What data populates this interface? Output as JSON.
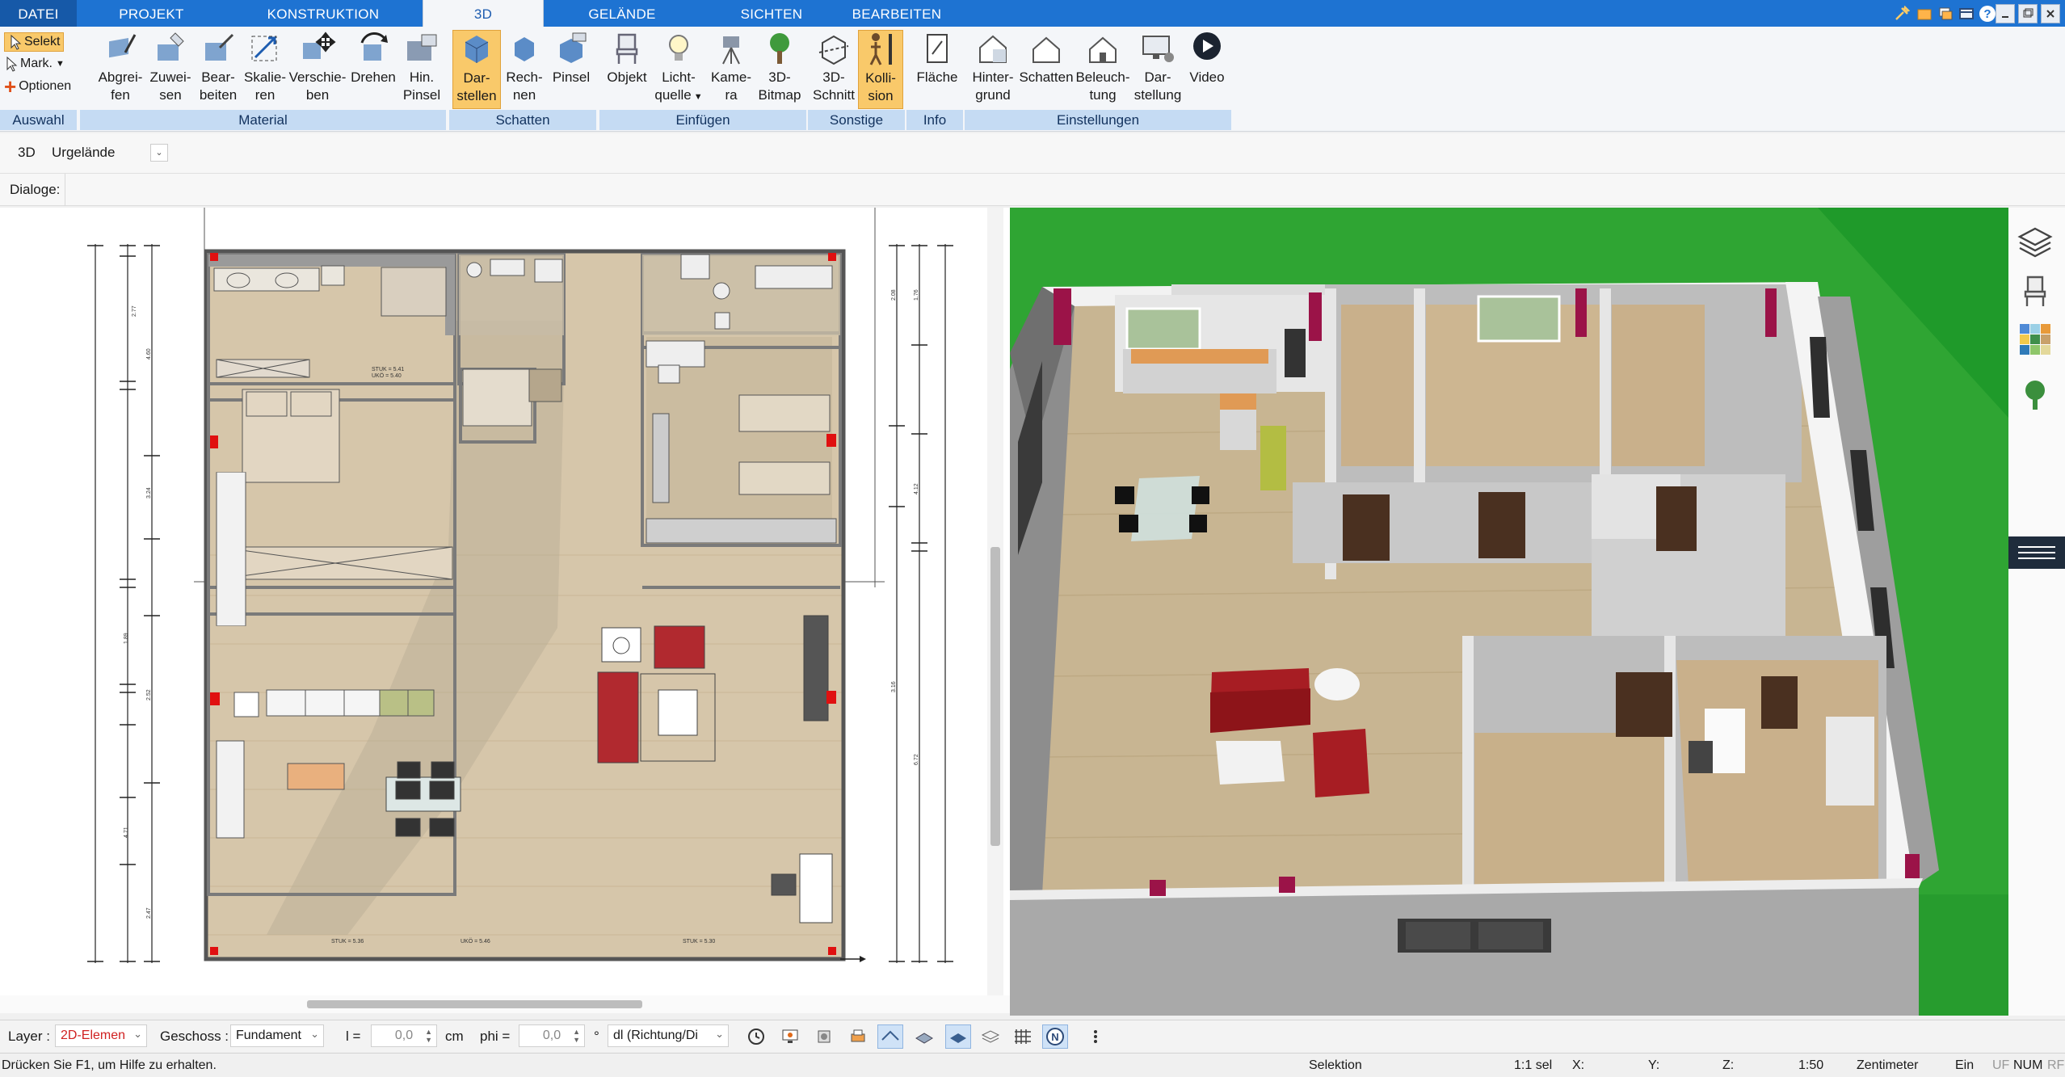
{
  "menu": {
    "tabs": [
      "DATEI",
      "PROJEKT",
      "KONSTRUKTION",
      "3D",
      "GELÄNDE",
      "SICHTEN",
      "BEARBEITEN"
    ],
    "active_tab": "3D"
  },
  "ribbon": {
    "auswahl": {
      "select_label": "Selekt",
      "mark_label": "Mark.",
      "options_label": "Optionen",
      "group": "Auswahl"
    },
    "material": {
      "group": "Material",
      "buttons": [
        {
          "l1": "Abgrei-",
          "l2": "fen"
        },
        {
          "l1": "Zuwei-",
          "l2": "sen"
        },
        {
          "l1": "Bear-",
          "l2": "beiten"
        },
        {
          "l1": "Skalie-",
          "l2": "ren"
        },
        {
          "l1": "Verschie-",
          "l2": "ben"
        },
        {
          "l1": "Drehen",
          "l2": ""
        },
        {
          "l1": "Hin.",
          "l2": "Pinsel"
        }
      ]
    },
    "schatten": {
      "group": "Schatten",
      "buttons": [
        {
          "l1": "Dar-",
          "l2": "stellen"
        },
        {
          "l1": "Rech-",
          "l2": "nen"
        },
        {
          "l1": "Pinsel",
          "l2": ""
        }
      ]
    },
    "einfuegen": {
      "group": "Einfügen",
      "buttons": [
        {
          "l1": "Objekt",
          "l2": ""
        },
        {
          "l1": "Licht-",
          "l2": "quelle"
        },
        {
          "l1": "Kame-",
          "l2": "ra"
        },
        {
          "l1": "3D-",
          "l2": "Bitmap"
        }
      ]
    },
    "sonstige": {
      "group": "Sonstige",
      "buttons": [
        {
          "l1": "3D-",
          "l2": "Schnitt"
        },
        {
          "l1": "Kolli-",
          "l2": "sion"
        }
      ]
    },
    "info": {
      "group": "Info",
      "buttons": [
        {
          "l1": "Fläche",
          "l2": ""
        }
      ]
    },
    "einstellungen": {
      "group": "Einstellungen",
      "buttons": [
        {
          "l1": "Hinter-",
          "l2": "grund"
        },
        {
          "l1": "Schatten",
          "l2": ""
        },
        {
          "l1": "Beleuch-",
          "l2": "tung"
        },
        {
          "l1": "Dar-",
          "l2": "stellung"
        },
        {
          "l1": "Video",
          "l2": ""
        }
      ]
    }
  },
  "toolbar": {
    "mode": "3D",
    "terrain": "Urgelände",
    "dialogs_label": "Dialoge:"
  },
  "bottom": {
    "layer_label": "Layer :",
    "layer_value": "2D-Elemen",
    "floor_label": "Geschoss :",
    "floor_value": "Fundament",
    "l_label": "l =",
    "l_value": "0,0",
    "l_unit": "cm",
    "phi_label": "phi =",
    "phi_value": "0,0",
    "phi_unit": "°",
    "dl_value": "dl (Richtung/Di"
  },
  "status": {
    "help": "Drücken Sie F1, um Hilfe zu erhalten.",
    "mode": "Selektion",
    "sel": "1:1 sel",
    "x": "X:",
    "y": "Y:",
    "z": "Z:",
    "scale": "1:50",
    "unit": "Zentimeter",
    "ein": "Ein",
    "uf": "UF",
    "num": "NUM",
    "rf": "RF"
  },
  "plan_labels": {
    "dims_left": [
      "2.77",
      "4.60",
      "3.24",
      "1.89",
      "2.52",
      "4.71",
      "2.47"
    ],
    "dims_right": [
      "2.08",
      "1.76",
      "4.12",
      "3.16",
      "6.72"
    ],
    "room_tags": [
      "STUK = 5.41",
      "UKÖ = 5.40",
      "STUK = 5.36",
      "UKÖ = 5.46",
      "STUK = 5.30"
    ]
  },
  "colors": {
    "brand": "#1e73d2",
    "highlight": "#f9c96a",
    "group_bg": "#c5dbf3",
    "wall_red": "#b0154c",
    "grass": "#2ea836",
    "floor": "#c9b391"
  }
}
